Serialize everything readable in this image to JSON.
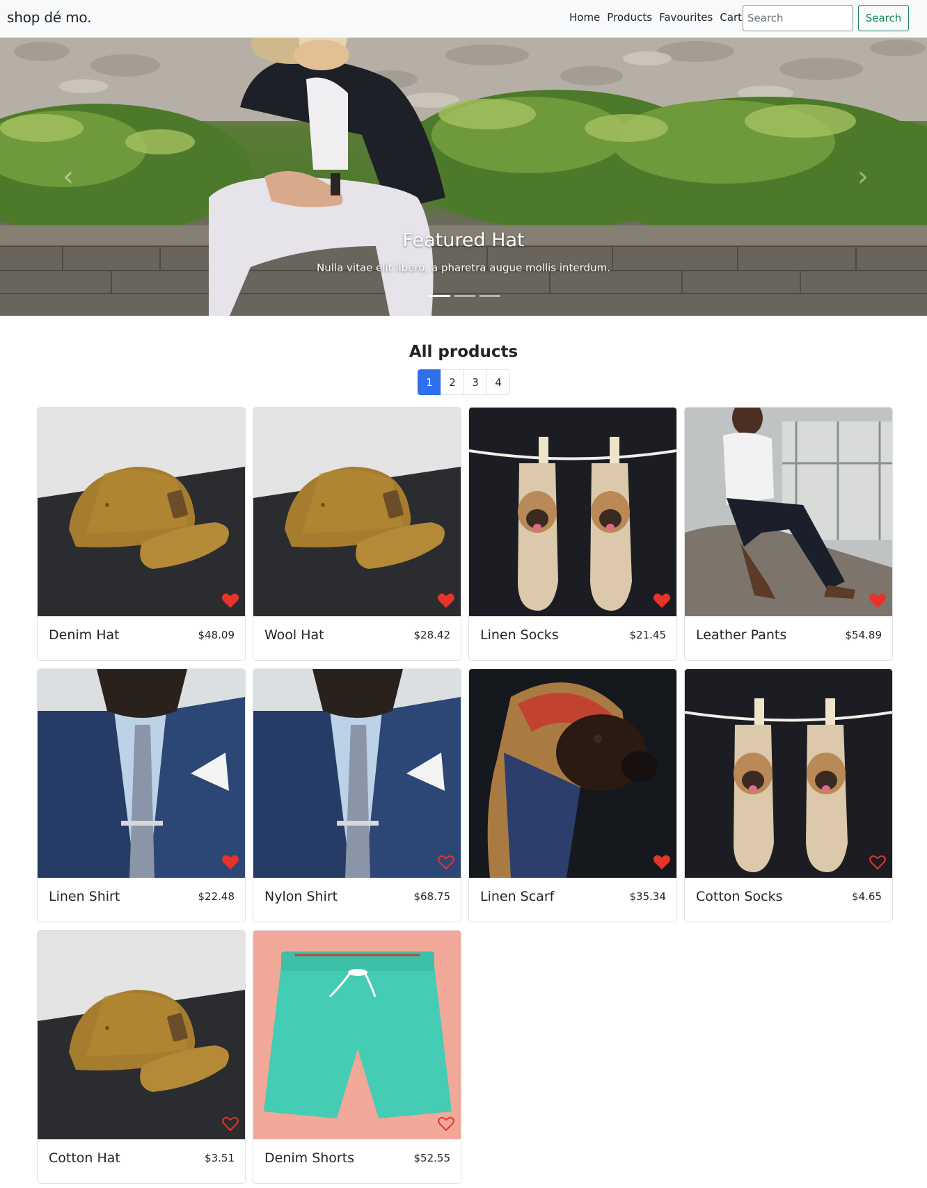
{
  "navbar": {
    "brand": "shop dé mo.",
    "links": [
      "Home",
      "Products",
      "Favourites",
      "Cart"
    ],
    "search_placeholder": "Search",
    "search_button": "Search"
  },
  "carousel": {
    "title": "Featured Hat",
    "subtitle": "Nulla vitae elit libero, a pharetra augue mollis interdum.",
    "slides": 3,
    "active_slide": 1
  },
  "products_section": {
    "title": "All products",
    "pages": [
      "1",
      "2",
      "3",
      "4"
    ],
    "active_page": "1"
  },
  "products": [
    {
      "name": "Denim Hat",
      "price": "$48.09",
      "favourite": true,
      "image": "cap"
    },
    {
      "name": "Wool Hat",
      "price": "$28.42",
      "favourite": true,
      "image": "cap"
    },
    {
      "name": "Linen Socks",
      "price": "$21.45",
      "favourite": true,
      "image": "socks"
    },
    {
      "name": "Leather Pants",
      "price": "$54.89",
      "favourite": true,
      "image": "man-sitting"
    },
    {
      "name": "Linen Shirt",
      "price": "$22.48",
      "favourite": true,
      "image": "suit"
    },
    {
      "name": "Nylon Shirt",
      "price": "$68.75",
      "favourite": false,
      "image": "suit"
    },
    {
      "name": "Linen Scarf",
      "price": "$35.34",
      "favourite": true,
      "image": "dog-scarf"
    },
    {
      "name": "Cotton Socks",
      "price": "$4.65",
      "favourite": false,
      "image": "socks"
    },
    {
      "name": "Cotton Hat",
      "price": "$3.51",
      "favourite": false,
      "image": "cap"
    },
    {
      "name": "Denim Shorts",
      "price": "$52.55",
      "favourite": false,
      "image": "shorts"
    }
  ],
  "colors": {
    "accent": "#2f6fed",
    "search_button": "#198754",
    "heart": "#e8332a",
    "navbar_bg": "#f8f9fa"
  }
}
